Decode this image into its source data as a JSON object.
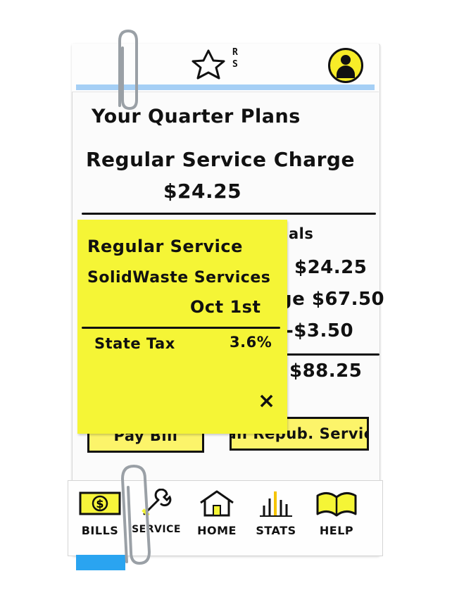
{
  "header": {
    "logo_letters": "R\nS",
    "avatar_icon": "user-icon"
  },
  "main": {
    "title": "Your Quarter Plans",
    "service_label": "Regular Service Charge",
    "service_amount": "$24.25",
    "billing_header": "Billing Details",
    "rows": [
      {
        "amount": "$24.25"
      },
      {
        "label": "ge",
        "amount": "$67.50"
      },
      {
        "amount": "-$3.50"
      }
    ],
    "total": "$88.25"
  },
  "popup": {
    "line1": "Regular Service",
    "line2": "SolidWaste Services",
    "line3": "Oct 1st",
    "tax_label": "State Tax",
    "tax_value": "3.6%",
    "close_glyph": "×"
  },
  "actions": {
    "pay_label": "Pay Bill",
    "call_label": "Call Repub. Service"
  },
  "nav": {
    "items": [
      {
        "label": "BILLS",
        "icon": "dollar-bill-icon"
      },
      {
        "label": "SERVICE",
        "icon": "wrench-icon"
      },
      {
        "label": "HOME",
        "icon": "house-icon"
      },
      {
        "label": "STATS",
        "icon": "bar-chart-icon"
      },
      {
        "label": "HELP",
        "icon": "book-icon"
      }
    ]
  },
  "colors": {
    "highlight_yellow": "#f5f536",
    "button_yellow": "#fcf46a",
    "accent_blue": "#8fc3f2"
  }
}
